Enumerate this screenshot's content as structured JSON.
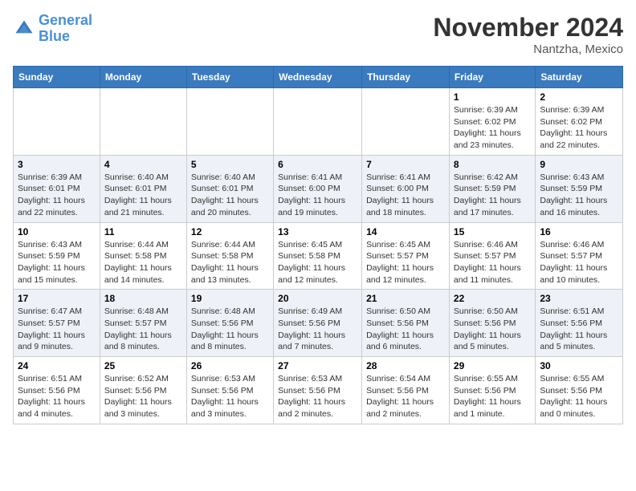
{
  "header": {
    "logo_line1": "General",
    "logo_line2": "Blue",
    "month": "November 2024",
    "location": "Nantzha, Mexico"
  },
  "weekdays": [
    "Sunday",
    "Monday",
    "Tuesday",
    "Wednesday",
    "Thursday",
    "Friday",
    "Saturday"
  ],
  "weeks": [
    [
      {
        "day": "",
        "info": ""
      },
      {
        "day": "",
        "info": ""
      },
      {
        "day": "",
        "info": ""
      },
      {
        "day": "",
        "info": ""
      },
      {
        "day": "",
        "info": ""
      },
      {
        "day": "1",
        "info": "Sunrise: 6:39 AM\nSunset: 6:02 PM\nDaylight: 11 hours and 23 minutes."
      },
      {
        "day": "2",
        "info": "Sunrise: 6:39 AM\nSunset: 6:02 PM\nDaylight: 11 hours and 22 minutes."
      }
    ],
    [
      {
        "day": "3",
        "info": "Sunrise: 6:39 AM\nSunset: 6:01 PM\nDaylight: 11 hours and 22 minutes."
      },
      {
        "day": "4",
        "info": "Sunrise: 6:40 AM\nSunset: 6:01 PM\nDaylight: 11 hours and 21 minutes."
      },
      {
        "day": "5",
        "info": "Sunrise: 6:40 AM\nSunset: 6:01 PM\nDaylight: 11 hours and 20 minutes."
      },
      {
        "day": "6",
        "info": "Sunrise: 6:41 AM\nSunset: 6:00 PM\nDaylight: 11 hours and 19 minutes."
      },
      {
        "day": "7",
        "info": "Sunrise: 6:41 AM\nSunset: 6:00 PM\nDaylight: 11 hours and 18 minutes."
      },
      {
        "day": "8",
        "info": "Sunrise: 6:42 AM\nSunset: 5:59 PM\nDaylight: 11 hours and 17 minutes."
      },
      {
        "day": "9",
        "info": "Sunrise: 6:43 AM\nSunset: 5:59 PM\nDaylight: 11 hours and 16 minutes."
      }
    ],
    [
      {
        "day": "10",
        "info": "Sunrise: 6:43 AM\nSunset: 5:59 PM\nDaylight: 11 hours and 15 minutes."
      },
      {
        "day": "11",
        "info": "Sunrise: 6:44 AM\nSunset: 5:58 PM\nDaylight: 11 hours and 14 minutes."
      },
      {
        "day": "12",
        "info": "Sunrise: 6:44 AM\nSunset: 5:58 PM\nDaylight: 11 hours and 13 minutes."
      },
      {
        "day": "13",
        "info": "Sunrise: 6:45 AM\nSunset: 5:58 PM\nDaylight: 11 hours and 12 minutes."
      },
      {
        "day": "14",
        "info": "Sunrise: 6:45 AM\nSunset: 5:57 PM\nDaylight: 11 hours and 12 minutes."
      },
      {
        "day": "15",
        "info": "Sunrise: 6:46 AM\nSunset: 5:57 PM\nDaylight: 11 hours and 11 minutes."
      },
      {
        "day": "16",
        "info": "Sunrise: 6:46 AM\nSunset: 5:57 PM\nDaylight: 11 hours and 10 minutes."
      }
    ],
    [
      {
        "day": "17",
        "info": "Sunrise: 6:47 AM\nSunset: 5:57 PM\nDaylight: 11 hours and 9 minutes."
      },
      {
        "day": "18",
        "info": "Sunrise: 6:48 AM\nSunset: 5:57 PM\nDaylight: 11 hours and 8 minutes."
      },
      {
        "day": "19",
        "info": "Sunrise: 6:48 AM\nSunset: 5:56 PM\nDaylight: 11 hours and 8 minutes."
      },
      {
        "day": "20",
        "info": "Sunrise: 6:49 AM\nSunset: 5:56 PM\nDaylight: 11 hours and 7 minutes."
      },
      {
        "day": "21",
        "info": "Sunrise: 6:50 AM\nSunset: 5:56 PM\nDaylight: 11 hours and 6 minutes."
      },
      {
        "day": "22",
        "info": "Sunrise: 6:50 AM\nSunset: 5:56 PM\nDaylight: 11 hours and 5 minutes."
      },
      {
        "day": "23",
        "info": "Sunrise: 6:51 AM\nSunset: 5:56 PM\nDaylight: 11 hours and 5 minutes."
      }
    ],
    [
      {
        "day": "24",
        "info": "Sunrise: 6:51 AM\nSunset: 5:56 PM\nDaylight: 11 hours and 4 minutes."
      },
      {
        "day": "25",
        "info": "Sunrise: 6:52 AM\nSunset: 5:56 PM\nDaylight: 11 hours and 3 minutes."
      },
      {
        "day": "26",
        "info": "Sunrise: 6:53 AM\nSunset: 5:56 PM\nDaylight: 11 hours and 3 minutes."
      },
      {
        "day": "27",
        "info": "Sunrise: 6:53 AM\nSunset: 5:56 PM\nDaylight: 11 hours and 2 minutes."
      },
      {
        "day": "28",
        "info": "Sunrise: 6:54 AM\nSunset: 5:56 PM\nDaylight: 11 hours and 2 minutes."
      },
      {
        "day": "29",
        "info": "Sunrise: 6:55 AM\nSunset: 5:56 PM\nDaylight: 11 hours and 1 minute."
      },
      {
        "day": "30",
        "info": "Sunrise: 6:55 AM\nSunset: 5:56 PM\nDaylight: 11 hours and 0 minutes."
      }
    ]
  ]
}
